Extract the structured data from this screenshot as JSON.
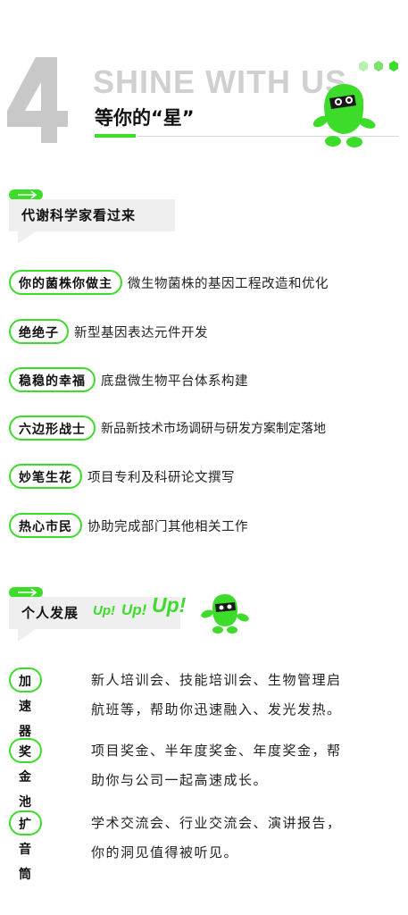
{
  "header": {
    "number": "4",
    "title_en": "SHINE WITH US",
    "title_cn": "等你的“星”"
  },
  "section1": {
    "title": "代谢科学家看过来",
    "items": [
      {
        "tag": "你的菌株你做主",
        "desc": "微生物菌株的基因工程改造和优化"
      },
      {
        "tag": "绝绝子",
        "desc": "新型基因表达元件开发"
      },
      {
        "tag": "稳稳的幸福",
        "desc": "底盘微生物平台体系构建"
      },
      {
        "tag": "六边形战士",
        "desc": "新品新技术市场调研与研发方案制定落地"
      },
      {
        "tag": "妙笔生花",
        "desc": "项目专利及科研论文撰写"
      },
      {
        "tag": "热心市民",
        "desc": "协助完成部门其他相关工作"
      }
    ]
  },
  "section2": {
    "title": "个人发展",
    "up1": "Up!",
    "up2": "Up!",
    "up3": "Up!",
    "items": [
      {
        "tag": "加速器",
        "line1": "新人培训会、技能培训会、生物管理启",
        "line2": "航班等，帮助你迅速融入、发光发热。"
      },
      {
        "tag": "奖金池",
        "line1": "项目奖金、半年度奖金、年度奖金，帮",
        "line2": "助你与公司一起高速成长。"
      },
      {
        "tag": "扩音筒",
        "line1": "学术交流会、行业交流会、演讲报告，",
        "line2": "你的洞见值得被听见。"
      }
    ]
  },
  "colors": {
    "accent": "#3ddc2b",
    "grey": "#c8c8c8",
    "box": "#efefef"
  }
}
